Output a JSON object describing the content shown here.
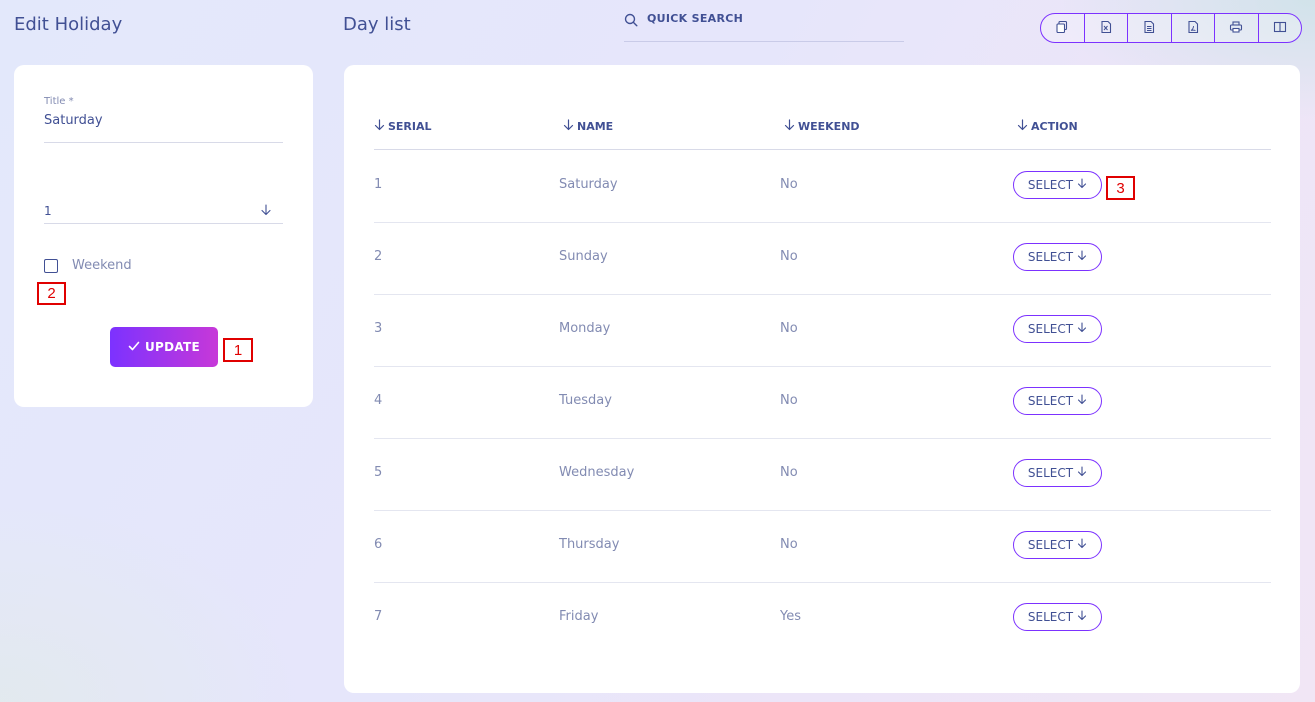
{
  "form": {
    "heading": "Edit Holiday",
    "title_label": "Title *",
    "title_value": "Saturday",
    "select_value": "1",
    "weekend_label": "Weekend",
    "weekend_checked": false,
    "update_label": "UPDATE"
  },
  "list": {
    "heading": "Day list",
    "search_placeholder": "QUICK SEARCH",
    "toolbar_icons": [
      "copy-icon",
      "excel-icon",
      "csv-icon",
      "pdf-icon",
      "print-icon",
      "columns-icon"
    ],
    "columns": [
      "SERIAL",
      "NAME",
      "WEEKEND",
      "ACTION"
    ],
    "rows": [
      {
        "serial": "1",
        "name": "Saturday",
        "weekend": "No",
        "action": "SELECT"
      },
      {
        "serial": "2",
        "name": "Sunday",
        "weekend": "No",
        "action": "SELECT"
      },
      {
        "serial": "3",
        "name": "Monday",
        "weekend": "No",
        "action": "SELECT"
      },
      {
        "serial": "4",
        "name": "Tuesday",
        "weekend": "No",
        "action": "SELECT"
      },
      {
        "serial": "5",
        "name": "Wednesday",
        "weekend": "No",
        "action": "SELECT"
      },
      {
        "serial": "6",
        "name": "Thursday",
        "weekend": "No",
        "action": "SELECT"
      },
      {
        "serial": "7",
        "name": "Friday",
        "weekend": "Yes",
        "action": "SELECT"
      }
    ]
  },
  "markers": [
    "1",
    "2",
    "3"
  ],
  "colors": {
    "accent": "#7c32ff",
    "accent_end": "#c738d8",
    "text": "#415094",
    "muted": "#828bb2",
    "marker": "#e00000"
  }
}
